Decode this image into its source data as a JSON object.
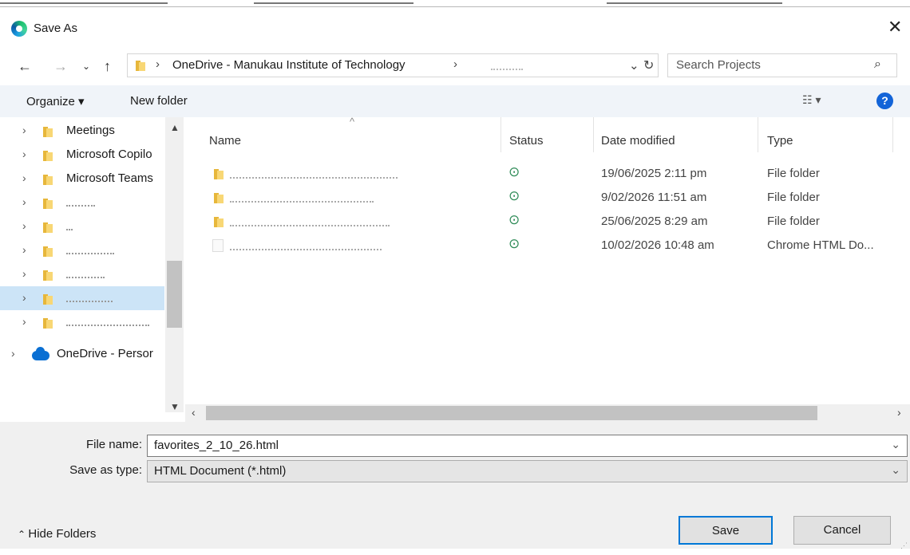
{
  "window": {
    "title": "Save As"
  },
  "address": {
    "breadcrumb": "OneDrive - Manukau Institute of Technology",
    "search_placeholder": "Search Projects"
  },
  "toolbar": {
    "organize": "Organize ▾",
    "new_folder": "New folder"
  },
  "nav": {
    "items": [
      {
        "label": "Meetings"
      },
      {
        "label": "Microsoft Copilo"
      },
      {
        "label": "Microsoft Teams"
      },
      {
        "label": ""
      },
      {
        "label": ""
      },
      {
        "label": ""
      },
      {
        "label": ""
      },
      {
        "label": ""
      },
      {
        "label": ""
      }
    ],
    "onedrive_personal": "OneDrive - Persor"
  },
  "columns": {
    "name": "Name",
    "status": "Status",
    "date_modified": "Date modified",
    "type": "Type"
  },
  "files": [
    {
      "name": "",
      "status": "synced",
      "date": "19/06/2025 2:11 pm",
      "type": "File folder"
    },
    {
      "name": "",
      "status": "synced",
      "date": "9/02/2026 11:51 am",
      "type": "File folder"
    },
    {
      "name": "",
      "status": "synced",
      "date": "25/06/2025 8:29 am",
      "type": "File folder"
    },
    {
      "name": "",
      "status": "synced",
      "date": "10/02/2026 10:48 am",
      "type": "Chrome HTML Do..."
    }
  ],
  "form": {
    "file_name_label": "File name:",
    "file_name_value": "favorites_2_10_26.html",
    "save_type_label": "Save as type:",
    "save_type_value": "HTML Document (*.html)"
  },
  "footer": {
    "hide_folders": "Hide Folders",
    "save": "Save",
    "cancel": "Cancel"
  },
  "colors": {
    "accent": "#0078d7",
    "selection": "#cce4f7",
    "toolbar_bg": "#f0f4f9"
  }
}
